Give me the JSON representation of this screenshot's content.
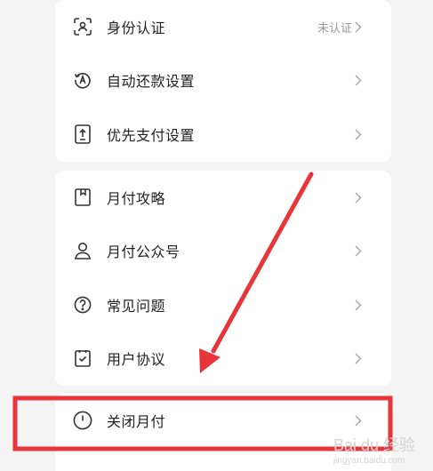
{
  "section1": {
    "items": [
      {
        "label": "身份认证",
        "status": "未认证",
        "icon": "id-scan-icon"
      },
      {
        "label": "自动还款设置",
        "icon": "auto-repay-icon"
      },
      {
        "label": "优先支付设置",
        "icon": "priority-pay-icon"
      }
    ]
  },
  "section2": {
    "items": [
      {
        "label": "月付攻略",
        "icon": "bookmark-icon"
      },
      {
        "label": "月付公众号",
        "icon": "user-icon"
      },
      {
        "label": "常见问题",
        "icon": "question-icon"
      },
      {
        "label": "用户协议",
        "icon": "agreement-icon"
      }
    ]
  },
  "section3": {
    "items": [
      {
        "label": "关闭月付",
        "icon": "power-icon"
      }
    ]
  },
  "annotation": {
    "color": "#e8353a"
  },
  "watermark": {
    "text": "Bai du 经验",
    "sub": "jingyan.baidu.com"
  }
}
